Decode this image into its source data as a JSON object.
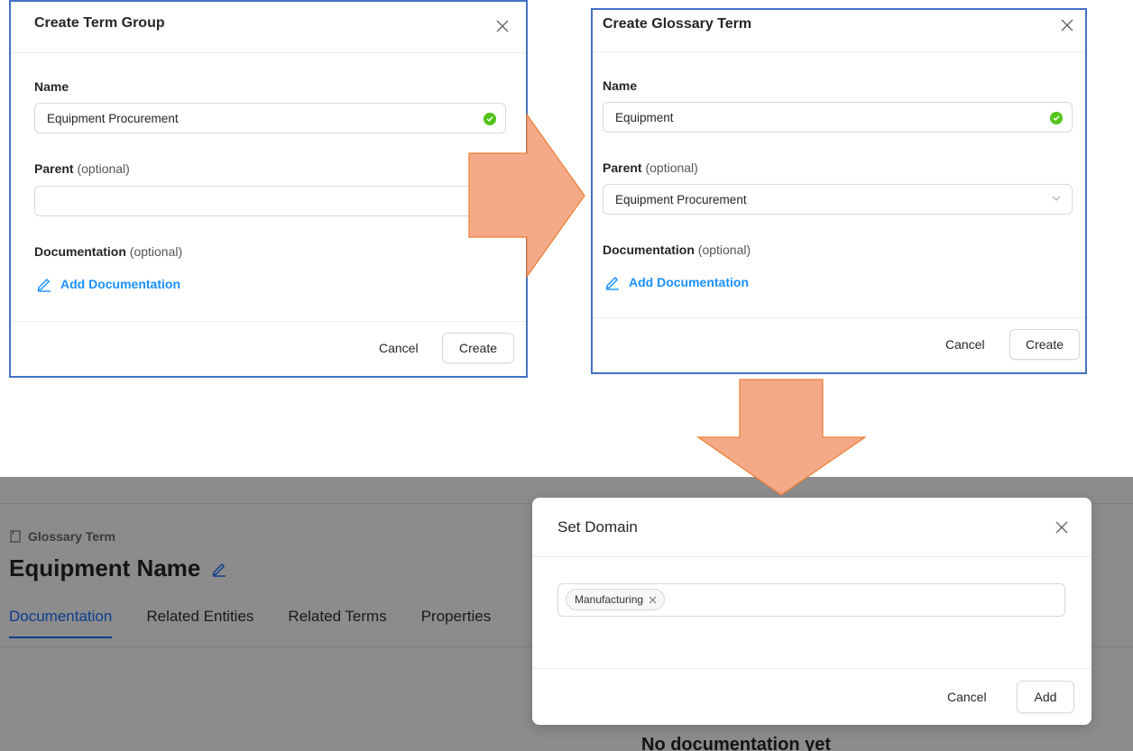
{
  "term_group_modal": {
    "title": "Create Term Group",
    "name_label": "Name",
    "name_value": "Equipment Procurement",
    "parent_label": "Parent",
    "parent_optional": "(optional)",
    "parent_value": "",
    "doc_label": "Documentation",
    "doc_optional": "(optional)",
    "add_doc_label": "Add Documentation",
    "cancel_label": "Cancel",
    "create_label": "Create"
  },
  "glossary_term_modal": {
    "title": "Create Glossary Term",
    "name_label": "Name",
    "name_value": "Equipment",
    "parent_label": "Parent",
    "parent_optional": "(optional)",
    "parent_value": "Equipment Procurement",
    "doc_label": "Documentation",
    "doc_optional": "(optional)",
    "add_doc_label": "Add Documentation",
    "cancel_label": "Cancel",
    "create_label": "Create"
  },
  "entity_page": {
    "breadcrumb": "Glossary Term",
    "title": "Equipment Name",
    "tabs": [
      "Documentation",
      "Related Entities",
      "Related Terms",
      "Properties"
    ],
    "active_tab": "Documentation",
    "empty_text": "No documentation yet"
  },
  "set_domain_modal": {
    "title": "Set Domain",
    "tag": "Manufacturing",
    "cancel_label": "Cancel",
    "add_label": "Add"
  },
  "colors": {
    "modal_outline": "#4472c4",
    "arrow_fill": "#f4a989",
    "arrow_stroke": "#ed7d31",
    "link": "#1890ff",
    "success": "#52c41a",
    "active_tab": "#0a3d8c",
    "overlay": "#8c8c8c"
  },
  "icons": [
    "close-icon",
    "check-circle-icon",
    "chevron-down-icon",
    "pencil-icon",
    "document-icon"
  ]
}
